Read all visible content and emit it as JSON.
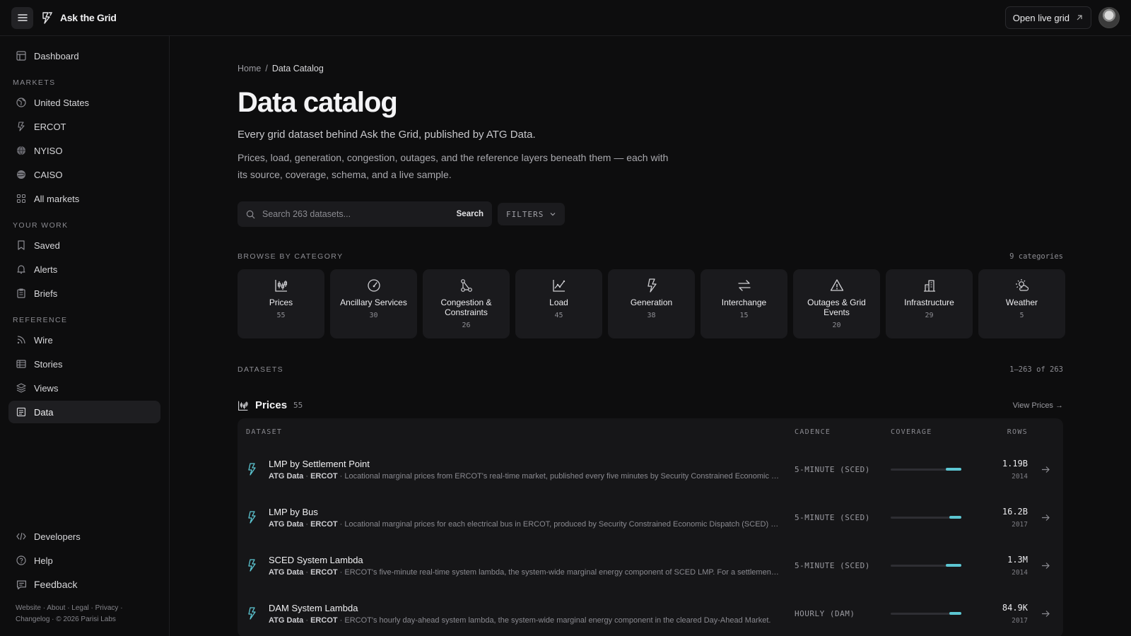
{
  "app": {
    "name": "Ask the Grid",
    "open_live": "Open live grid"
  },
  "sidebar": {
    "dashboard": "Dashboard",
    "markets_label": "MARKETS",
    "markets": [
      "United States",
      "ERCOT",
      "NYISO",
      "CAISO",
      "All markets"
    ],
    "work_label": "YOUR WORK",
    "work": [
      "Saved",
      "Alerts",
      "Briefs"
    ],
    "reference_label": "REFERENCE",
    "reference": [
      "Wire",
      "Stories",
      "Views",
      "Data"
    ],
    "developers": "Developers",
    "help": "Help",
    "feedback": "Feedback",
    "footer_line1": "Website · About · Legal · Privacy ·",
    "footer_line2": "Changelog · © 2026 Parisi Labs"
  },
  "breadcrumb": {
    "home": "Home",
    "sep": "/",
    "current": "Data Catalog"
  },
  "page": {
    "title": "Data catalog",
    "subtitle": "Every grid dataset behind Ask the Grid, published by ATG Data.",
    "description": "Prices, load, generation, congestion, outages, and the reference layers beneath them — each with its source, coverage, schema, and a live sample."
  },
  "search": {
    "placeholder": "Search 263 datasets...",
    "button": "Search",
    "filters": "FILTERS"
  },
  "categories_section": {
    "label": "BROWSE BY CATEGORY",
    "count": "9 categories",
    "items": [
      {
        "name": "Prices",
        "count": "55",
        "icon": "candlestick-icon"
      },
      {
        "name": "Ancillary Services",
        "count": "30",
        "icon": "gauge-icon"
      },
      {
        "name": "Congestion & Constraints",
        "count": "26",
        "icon": "network-icon"
      },
      {
        "name": "Load",
        "count": "45",
        "icon": "line-chart-icon"
      },
      {
        "name": "Generation",
        "count": "38",
        "icon": "bolt-icon"
      },
      {
        "name": "Interchange",
        "count": "15",
        "icon": "arrows-exchange-icon"
      },
      {
        "name": "Outages & Grid Events",
        "count": "20",
        "icon": "warning-icon"
      },
      {
        "name": "Infrastructure",
        "count": "29",
        "icon": "building-icon"
      },
      {
        "name": "Weather",
        "count": "5",
        "icon": "sun-cloud-icon"
      }
    ]
  },
  "datasets_section": {
    "label": "DATASETS",
    "range": "1–263 of 263"
  },
  "group": {
    "title": "Prices",
    "count": "55",
    "view_link": "View Prices →",
    "columns": {
      "dataset": "DATASET",
      "cadence": "CADENCE",
      "coverage": "COVERAGE",
      "rows": "ROWS"
    },
    "rows": [
      {
        "name": "LMP by Settlement Point",
        "publisher": "ATG Data",
        "market": "ERCOT",
        "description": "Locational marginal prices from ERCOT's real-time market, published every five minutes by Security Constrained Economic Dispatch (SCED).",
        "cadence": "5-MINUTE (SCED)",
        "coverage": 0.22,
        "rows": "1.19B",
        "since": "2014"
      },
      {
        "name": "LMP by Bus",
        "publisher": "ATG Data",
        "market": "ERCOT",
        "description": "Locational marginal prices for each electrical bus in ERCOT, produced by Security Constrained Economic Dispatch (SCED) every five minutes.",
        "cadence": "5-MINUTE (SCED)",
        "coverage": 0.17,
        "rows": "16.2B",
        "since": "2017"
      },
      {
        "name": "SCED System Lambda",
        "publisher": "ATG Data",
        "market": "ERCOT",
        "description": "ERCOT's five-minute real-time system lambda, the system-wide marginal energy component of SCED LMP. For a settlement point price, see LMP.",
        "cadence": "5-MINUTE (SCED)",
        "coverage": 0.22,
        "rows": "1.3M",
        "since": "2014"
      },
      {
        "name": "DAM System Lambda",
        "publisher": "ATG Data",
        "market": "ERCOT",
        "description": "ERCOT's hourly day-ahead system lambda, the system-wide marginal energy component in the cleared Day-Ahead Market.",
        "cadence": "HOURLY (DAM)",
        "coverage": 0.17,
        "rows": "84.9K",
        "since": "2017"
      }
    ]
  },
  "colors": {
    "accent": "#5cc6d2",
    "background": "#0d0d0e",
    "card": "#1a1a1d"
  }
}
